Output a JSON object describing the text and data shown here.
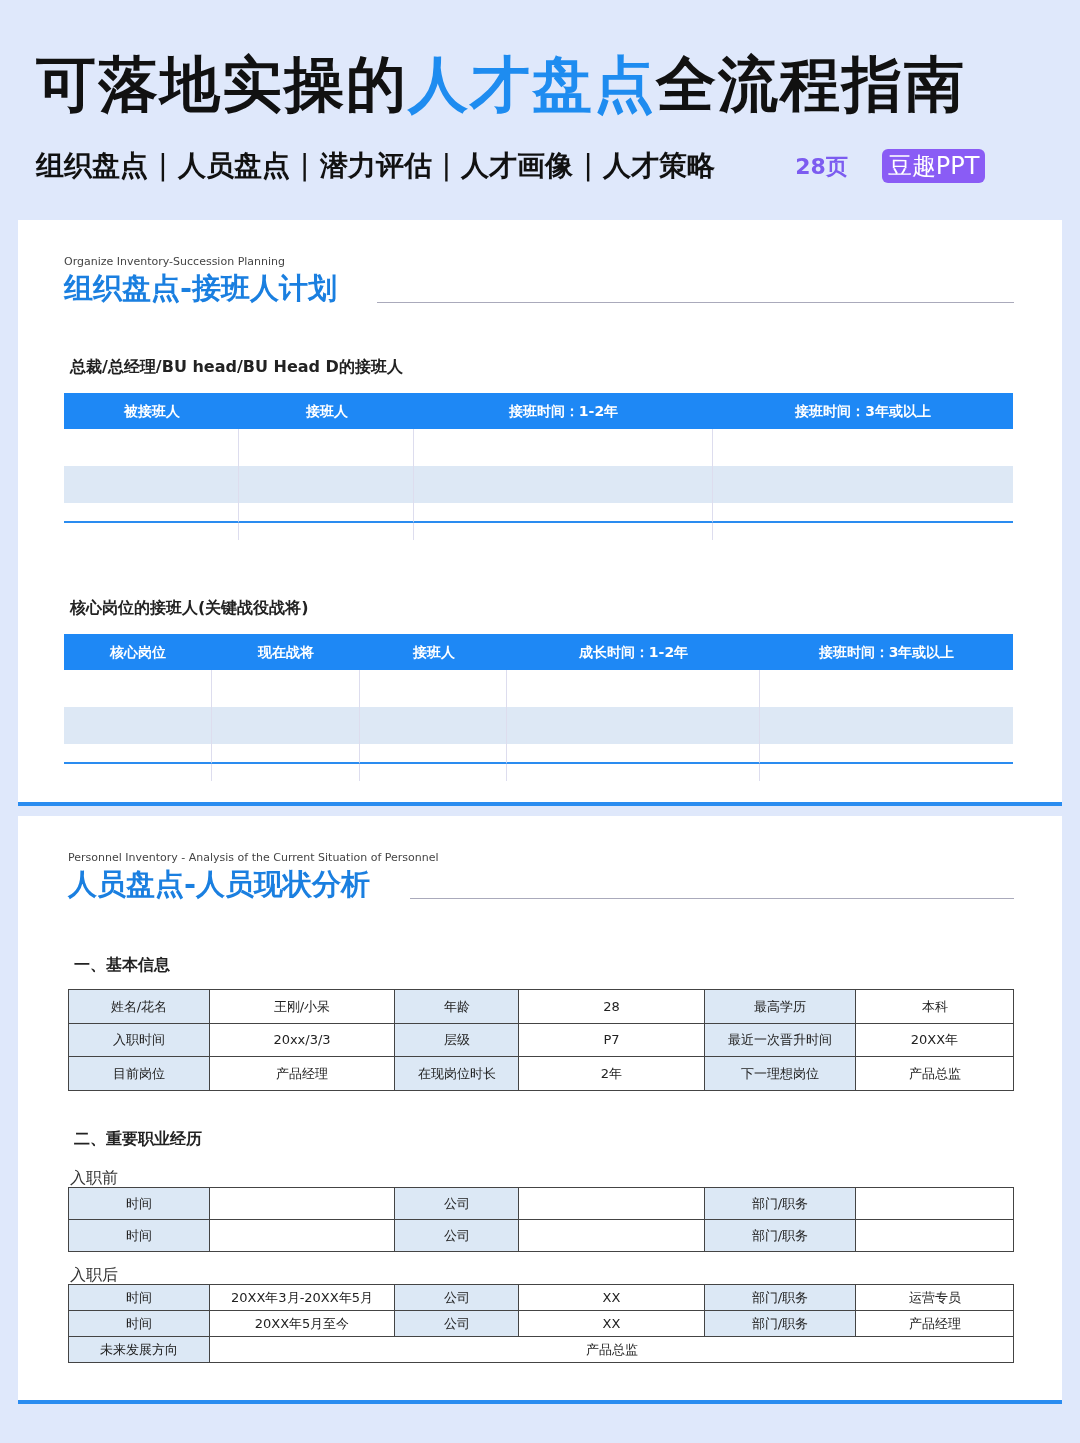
{
  "header": {
    "title_parts": [
      {
        "text": "可落地实操的",
        "kind": "plain"
      },
      {
        "text": "人才盘点",
        "kind": "accent"
      },
      {
        "text": "全流程指南",
        "kind": "plain"
      }
    ],
    "topics": [
      "组织盘点",
      "人员盘点",
      "潜力评估",
      "人才画像",
      "人才策略"
    ],
    "separator": "|",
    "page_count": "28页",
    "brand": "豆趣PPT"
  },
  "slide_1": {
    "subtitle": "Organize Inventory-Succession Planning",
    "title": "组织盘点-接班人计划",
    "sections": [
      {
        "heading": "总裁/总经理/BU head/BU Head D的接班人",
        "columns": [
          "被接班人",
          "接班人",
          "接班时间：1-2年",
          "接班时间：3年或以上"
        ]
      },
      {
        "heading": "核心岗位的接班人(关键战役战将)",
        "columns": [
          "核心岗位",
          "现在战将",
          "接班人",
          "成长时间：1-2年",
          "接班时间：3年或以上"
        ]
      }
    ]
  },
  "slide_2": {
    "subtitle": "Personnel Inventory - Analysis of the Current Situation of Personnel",
    "title": "人员盘点-人员现状分析",
    "basic_heading": "一、基本信息",
    "basic_rows": [
      [
        {
          "kind": "label",
          "text": "姓名/花名"
        },
        {
          "kind": "value",
          "text": "王刚/小呆"
        },
        {
          "kind": "label",
          "text": "年龄"
        },
        {
          "kind": "value",
          "text": "28"
        },
        {
          "kind": "label",
          "text": "最高学历"
        },
        {
          "kind": "value",
          "text": "本科"
        }
      ],
      [
        {
          "kind": "label",
          "text": "入职时间"
        },
        {
          "kind": "value",
          "text": "20xx/3/3"
        },
        {
          "kind": "label",
          "text": "层级"
        },
        {
          "kind": "value",
          "text": "P7"
        },
        {
          "kind": "label",
          "text": "最近一次晋升时间"
        },
        {
          "kind": "value",
          "text": "20XX年"
        }
      ],
      [
        {
          "kind": "label",
          "text": "目前岗位"
        },
        {
          "kind": "value",
          "text": "产品经理"
        },
        {
          "kind": "label",
          "text": "在现岗位时长"
        },
        {
          "kind": "value",
          "text": "2年"
        },
        {
          "kind": "label",
          "text": "下一理想岗位"
        },
        {
          "kind": "value",
          "text": "产品总监"
        }
      ]
    ],
    "career_heading": "二、重要职业经历",
    "groups": [
      {
        "label": "入职前",
        "rows": [
          [
            {
              "kind": "label",
              "text": "时间"
            },
            {
              "kind": "value"
            },
            {
              "kind": "label",
              "text": "公司"
            },
            {
              "kind": "value"
            },
            {
              "kind": "label",
              "text": "部门/职务"
            },
            {
              "kind": "value"
            }
          ],
          [
            {
              "kind": "label",
              "text": "时间"
            },
            {
              "kind": "value"
            },
            {
              "kind": "label",
              "text": "公司"
            },
            {
              "kind": "value"
            },
            {
              "kind": "label",
              "text": "部门/职务"
            },
            {
              "kind": "value"
            }
          ]
        ]
      },
      {
        "label": "入职后",
        "rows": [
          [
            {
              "kind": "label",
              "text": "时间"
            },
            {
              "kind": "value",
              "text": "20XX年3月-20XX年5月"
            },
            {
              "kind": "label",
              "text": "公司"
            },
            {
              "kind": "value",
              "text": "XX"
            },
            {
              "kind": "label",
              "text": "部门/职务"
            },
            {
              "kind": "value",
              "text": "运营专员"
            }
          ],
          [
            {
              "kind": "label",
              "text": "时间"
            },
            {
              "kind": "value",
              "text": "20XX年5月至今"
            },
            {
              "kind": "label",
              "text": "公司"
            },
            {
              "kind": "value",
              "text": "XX"
            },
            {
              "kind": "label",
              "text": "部门/职务"
            },
            {
              "kind": "value",
              "text": "产品经理"
            }
          ]
        ],
        "future": {
          "label": "未来发展方向",
          "value": "产品总监"
        }
      }
    ]
  }
}
